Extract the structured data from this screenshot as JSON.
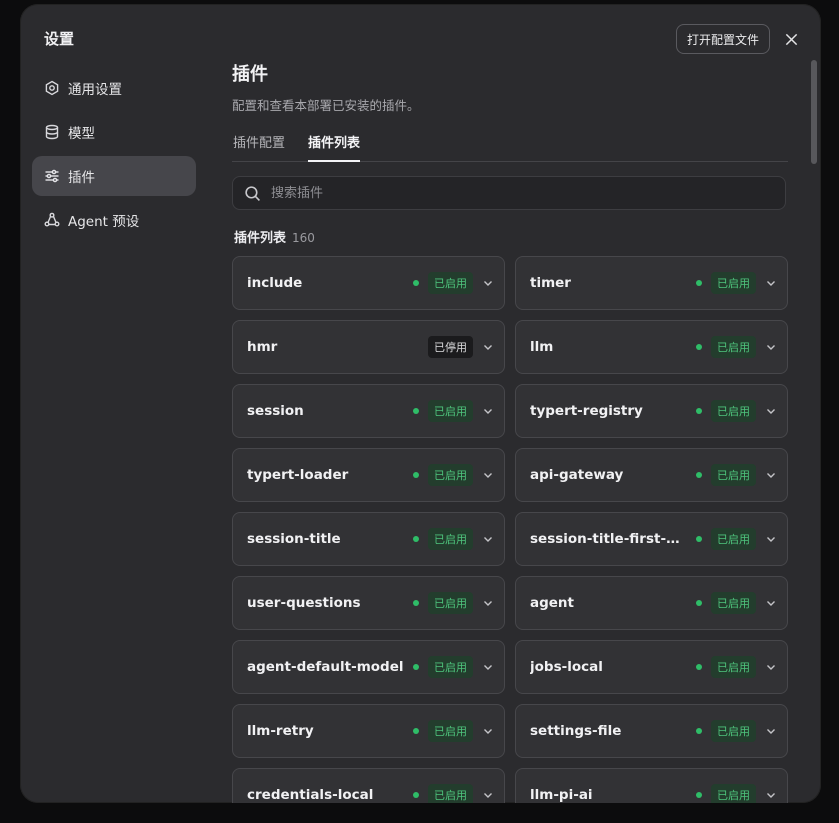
{
  "modal": {
    "title": "设置",
    "open_config_button": "打开配置文件"
  },
  "sidebar": {
    "items": [
      {
        "label": "通用设置",
        "icon": "gear-icon",
        "active": false
      },
      {
        "label": "模型",
        "icon": "database-icon",
        "active": false
      },
      {
        "label": "插件",
        "icon": "sliders-icon",
        "active": true
      },
      {
        "label": "Agent 预设",
        "icon": "agent-icon",
        "active": false
      }
    ]
  },
  "main": {
    "title": "插件",
    "description": "配置和查看本部署已安装的插件。",
    "tabs": [
      {
        "label": "插件配置",
        "active": false
      },
      {
        "label": "插件列表",
        "active": true
      }
    ],
    "search_placeholder": "搜索插件",
    "list_title": "插件列表",
    "list_count": "160"
  },
  "plugins": [
    {
      "name": "include",
      "status": "已启用",
      "enabled": true
    },
    {
      "name": "timer",
      "status": "已启用",
      "enabled": true
    },
    {
      "name": "hmr",
      "status": "已停用",
      "enabled": false
    },
    {
      "name": "llm",
      "status": "已启用",
      "enabled": true
    },
    {
      "name": "session",
      "status": "已启用",
      "enabled": true
    },
    {
      "name": "typert-registry",
      "status": "已启用",
      "enabled": true
    },
    {
      "name": "typert-loader",
      "status": "已启用",
      "enabled": true
    },
    {
      "name": "api-gateway",
      "status": "已启用",
      "enabled": true
    },
    {
      "name": "session-title",
      "status": "已启用",
      "enabled": true
    },
    {
      "name": "session-title-first-prompt",
      "status": "已启用",
      "enabled": true
    },
    {
      "name": "user-questions",
      "status": "已启用",
      "enabled": true
    },
    {
      "name": "agent",
      "status": "已启用",
      "enabled": true
    },
    {
      "name": "agent-default-model",
      "status": "已启用",
      "enabled": true
    },
    {
      "name": "jobs-local",
      "status": "已启用",
      "enabled": true
    },
    {
      "name": "llm-retry",
      "status": "已启用",
      "enabled": true
    },
    {
      "name": "settings-file",
      "status": "已启用",
      "enabled": true
    },
    {
      "name": "credentials-local",
      "status": "已启用",
      "enabled": true
    },
    {
      "name": "llm-pi-ai",
      "status": "已启用",
      "enabled": true
    }
  ],
  "colors": {
    "enabled": "#2fbd68",
    "modal_bg": "#2b2b2e",
    "active_nav": "#46464b"
  }
}
